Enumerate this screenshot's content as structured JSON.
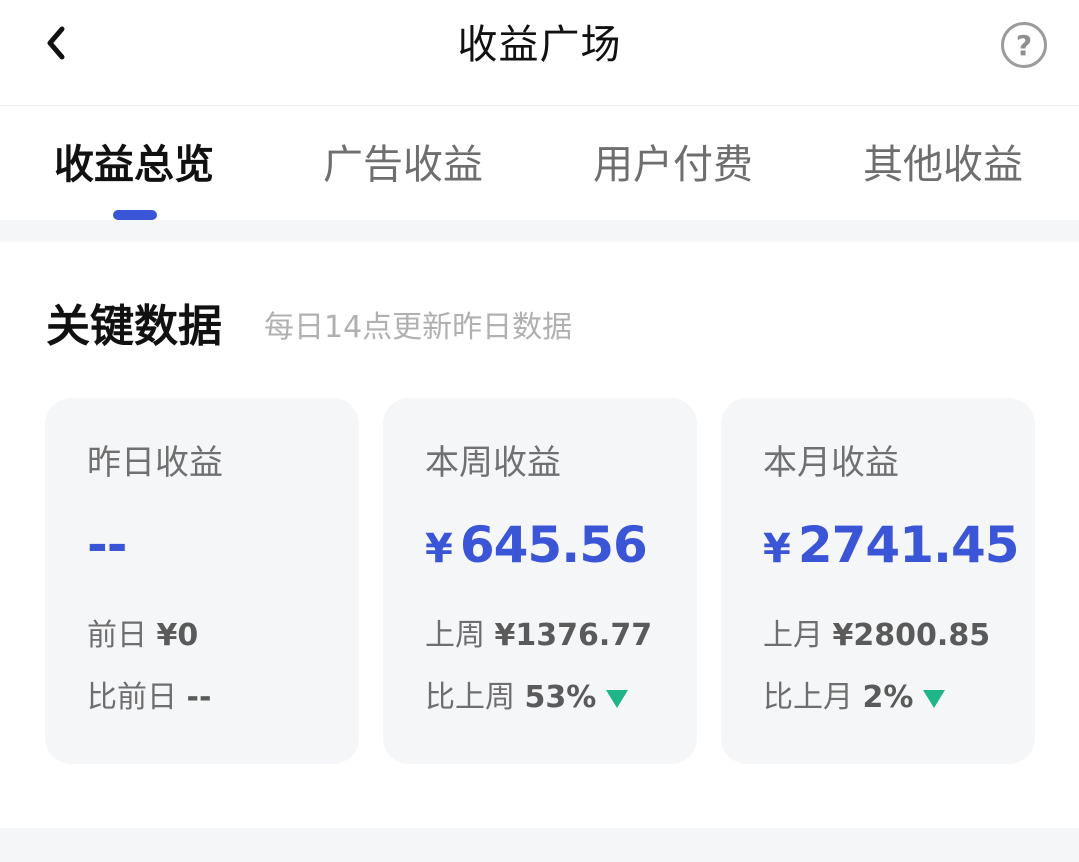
{
  "header": {
    "title": "收益广场"
  },
  "tabs": [
    {
      "label": "收益总览"
    },
    {
      "label": "广告收益"
    },
    {
      "label": "用户付费"
    },
    {
      "label": "其他收益"
    }
  ],
  "section": {
    "title": "关键数据",
    "subtitle": "每日14点更新昨日数据"
  },
  "cards": [
    {
      "label": "昨日收益",
      "value": "--",
      "prev_label": "前日",
      "prev_value": "¥0",
      "compare_label": "比前日",
      "compare_value": "--"
    },
    {
      "label": "本周收益",
      "value": "645.56",
      "currency": "¥",
      "prev_label": "上周",
      "prev_value": "¥1376.77",
      "compare_label": "比上周",
      "compare_value": "53%",
      "trend": "down"
    },
    {
      "label": "本月收益",
      "value": "2741.45",
      "currency": "¥",
      "prev_label": "上月",
      "prev_value": "¥2800.85",
      "compare_label": "比上月",
      "compare_value": "2%",
      "trend": "down"
    }
  ],
  "colors": {
    "accent": "#3a55d6",
    "trend_down": "#1fb589"
  },
  "icons": {
    "back": "chevron-left-icon",
    "help": "question-circle-icon",
    "trend": "triangle-down-icon"
  }
}
